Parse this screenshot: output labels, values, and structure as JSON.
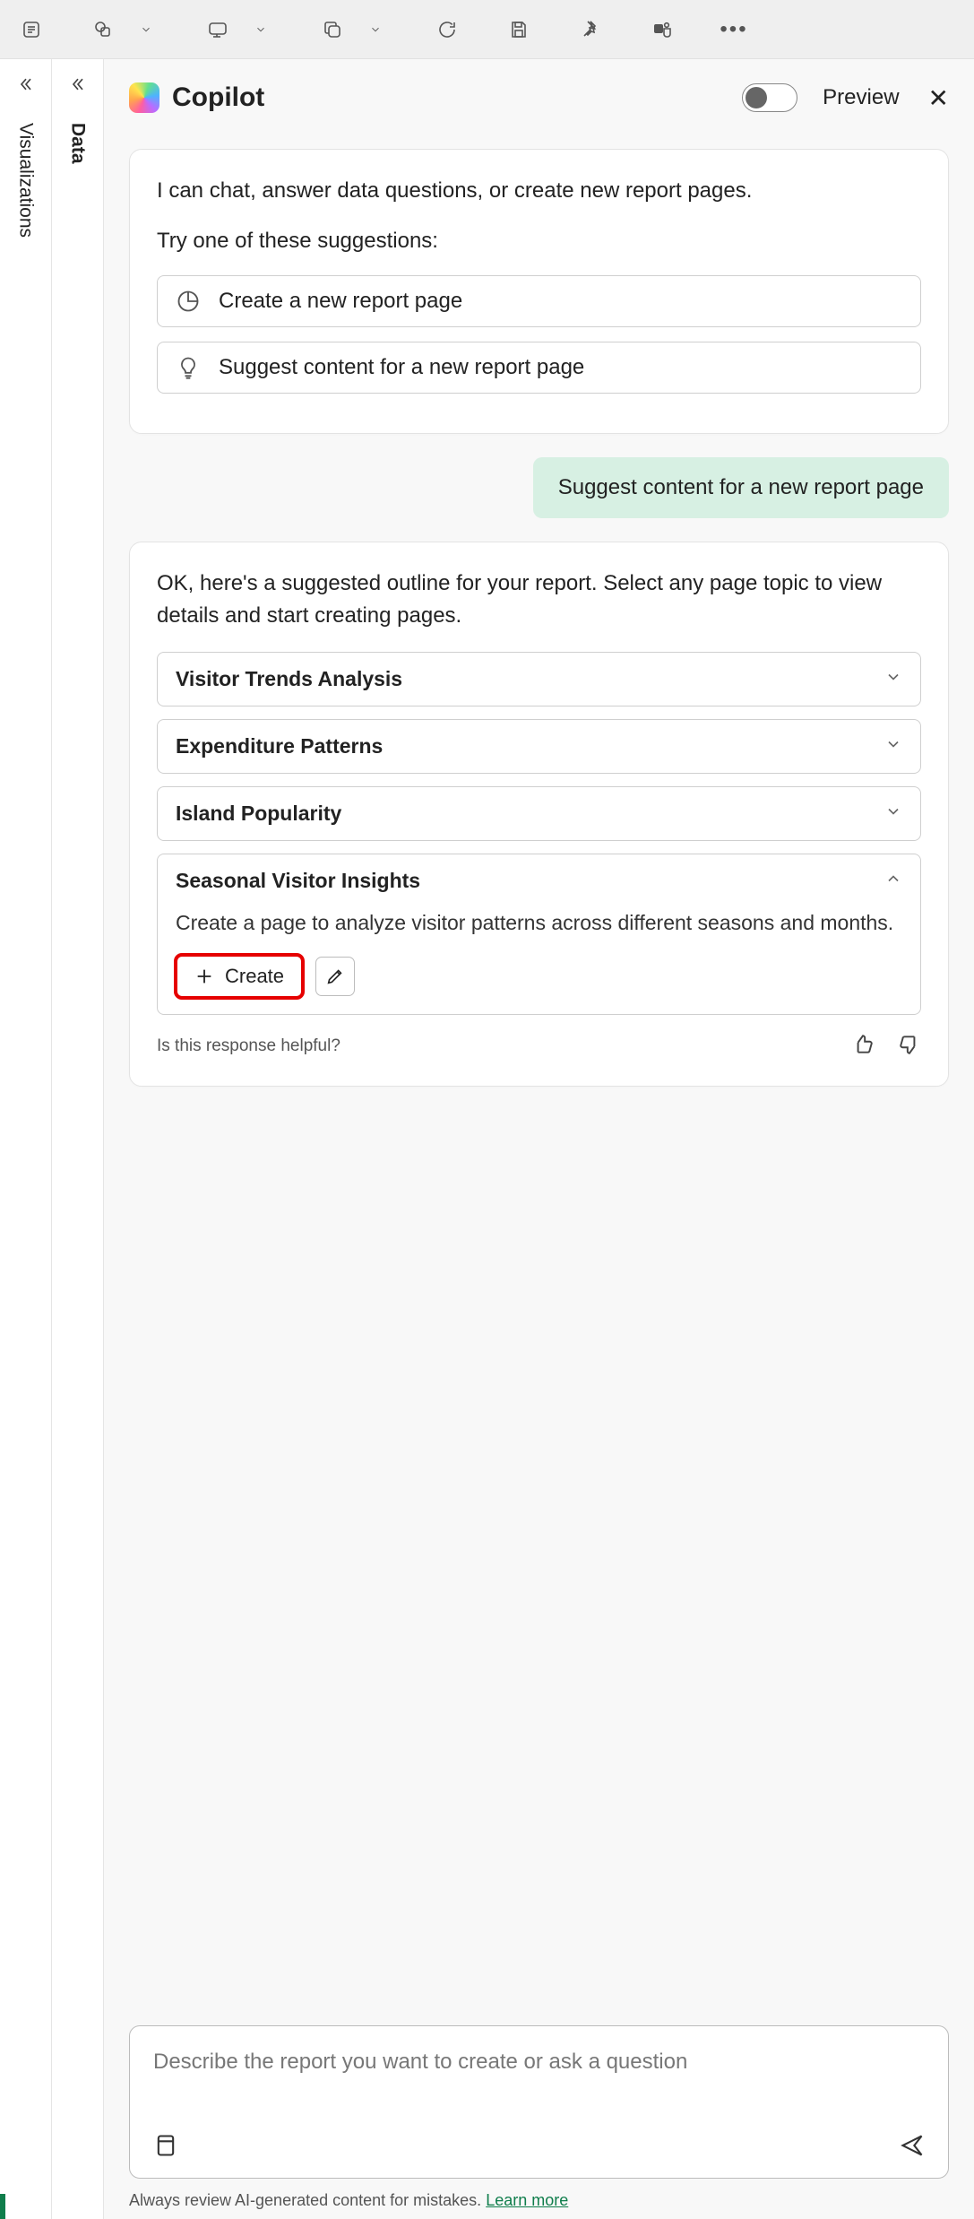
{
  "rails": {
    "data": "Data",
    "viz": "Visualizations"
  },
  "header": {
    "title": "Copilot",
    "preview": "Preview"
  },
  "intro": {
    "text": "I can chat, answer data questions, or create new report pages.",
    "try": "Try one of these suggestions:",
    "sugg1": "Create a new report page",
    "sugg2": "Suggest content for a new report page"
  },
  "user_msg": "Suggest content for a new report page",
  "outline": {
    "text": "OK, here's a suggested outline for your report. Select any page topic to view details and start creating pages.",
    "items": [
      {
        "title": "Visitor Trends Analysis"
      },
      {
        "title": "Expenditure Patterns"
      },
      {
        "title": "Island Popularity"
      },
      {
        "title": "Seasonal Visitor Insights",
        "desc": "Create a page to analyze visitor patterns across different seasons and months.",
        "expanded": true,
        "create_label": "Create"
      }
    ]
  },
  "feedback": {
    "text": "Is this response helpful?"
  },
  "input": {
    "placeholder": "Describe the report you want to create or ask a question"
  },
  "disclaimer": {
    "text": "Always review AI-generated content for mistakes. ",
    "link": "Learn more"
  }
}
